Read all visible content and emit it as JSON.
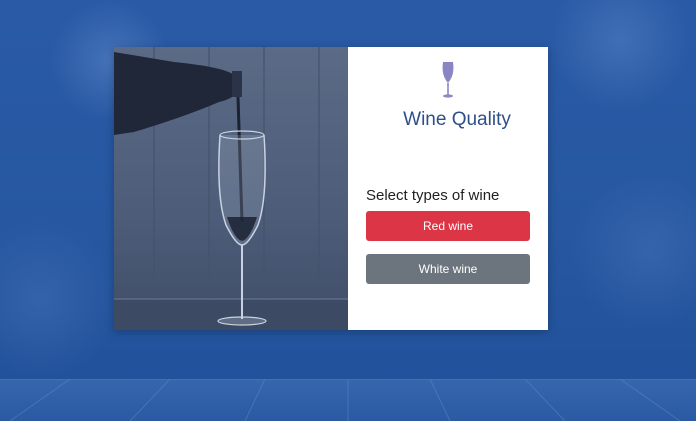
{
  "app": {
    "title": "Wine Quality",
    "prompt": "Select types of wine",
    "icon": "wine-glass-icon"
  },
  "buttons": {
    "red": "Red wine",
    "white": "White wine"
  },
  "colors": {
    "background": "#2657a0",
    "title": "#2e4f8a",
    "red_button": "#dc3545",
    "white_button": "#6c757d",
    "glass_icon": "#8a86c4"
  }
}
